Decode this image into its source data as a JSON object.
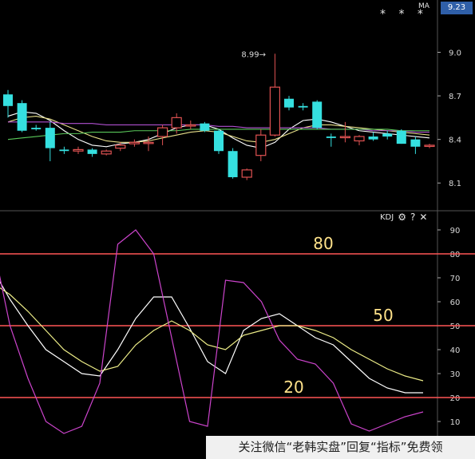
{
  "toolbar": {
    "current_price": "9.23",
    "ma_label": "MA",
    "stars": "* * *",
    "kdj_label": "KDJ",
    "gear_icon": "⚙",
    "help_icon": "?",
    "close_icon": "✕"
  },
  "watermark": "关注微信“老韩实盘”回复“指标”免费领",
  "colors": {
    "up": "#e05252",
    "down": "#35e0e0",
    "k_line": "#ffffff",
    "d_line": "#eeee88",
    "j_line": "#cc44cc",
    "ref_line": "#ff5555",
    "ref_label": "#ffe28a",
    "ma_white": "#ffffff",
    "ma_yellow": "#e8e08a",
    "ma_purple": "#b050d0",
    "ma_green": "#5ac85a"
  },
  "chart_data": [
    {
      "type": "candlestick",
      "title": "",
      "y_ticks": [
        "9.0",
        "8.7",
        "8.4",
        "8.1"
      ],
      "ylim": [
        7.92,
        9.25
      ],
      "annotation": {
        "text": "8.99",
        "candle_index": 19
      },
      "candles": [
        {
          "o": 8.71,
          "h": 8.74,
          "l": 8.55,
          "c": 8.63
        },
        {
          "o": 8.65,
          "h": 8.67,
          "l": 8.45,
          "c": 8.46
        },
        {
          "o": 8.48,
          "h": 8.5,
          "l": 8.46,
          "c": 8.47
        },
        {
          "o": 8.48,
          "h": 8.52,
          "l": 8.25,
          "c": 8.34
        },
        {
          "o": 8.33,
          "h": 8.35,
          "l": 8.3,
          "c": 8.32
        },
        {
          "o": 8.32,
          "h": 8.35,
          "l": 8.3,
          "c": 8.33
        },
        {
          "o": 8.33,
          "h": 8.34,
          "l": 8.28,
          "c": 8.3
        },
        {
          "o": 8.3,
          "h": 8.33,
          "l": 8.29,
          "c": 8.32
        },
        {
          "o": 8.34,
          "h": 8.38,
          "l": 8.32,
          "c": 8.36
        },
        {
          "o": 8.37,
          "h": 8.4,
          "l": 8.35,
          "c": 8.38
        },
        {
          "o": 8.38,
          "h": 8.42,
          "l": 8.32,
          "c": 8.38
        },
        {
          "o": 8.42,
          "h": 8.5,
          "l": 8.36,
          "c": 8.48
        },
        {
          "o": 8.48,
          "h": 8.58,
          "l": 8.44,
          "c": 8.55
        },
        {
          "o": 8.5,
          "h": 8.53,
          "l": 8.47,
          "c": 8.5
        },
        {
          "o": 8.51,
          "h": 8.52,
          "l": 8.45,
          "c": 8.46
        },
        {
          "o": 8.46,
          "h": 8.47,
          "l": 8.3,
          "c": 8.32
        },
        {
          "o": 8.32,
          "h": 8.34,
          "l": 8.13,
          "c": 8.14
        },
        {
          "o": 8.14,
          "h": 8.2,
          "l": 8.12,
          "c": 8.19
        },
        {
          "o": 8.29,
          "h": 8.47,
          "l": 8.25,
          "c": 8.43
        },
        {
          "o": 8.43,
          "h": 8.99,
          "l": 8.42,
          "c": 8.76
        },
        {
          "o": 8.68,
          "h": 8.7,
          "l": 8.6,
          "c": 8.62
        },
        {
          "o": 8.63,
          "h": 8.65,
          "l": 8.6,
          "c": 8.62
        },
        {
          "o": 8.66,
          "h": 8.67,
          "l": 8.47,
          "c": 8.48
        },
        {
          "o": 8.42,
          "h": 8.44,
          "l": 8.35,
          "c": 8.41
        },
        {
          "o": 8.42,
          "h": 8.52,
          "l": 8.38,
          "c": 8.42
        },
        {
          "o": 8.39,
          "h": 8.43,
          "l": 8.36,
          "c": 8.42
        },
        {
          "o": 8.42,
          "h": 8.45,
          "l": 8.39,
          "c": 8.4
        },
        {
          "o": 8.44,
          "h": 8.46,
          "l": 8.4,
          "c": 8.42
        },
        {
          "o": 8.46,
          "h": 8.47,
          "l": 8.37,
          "c": 8.37
        },
        {
          "o": 8.4,
          "h": 8.42,
          "l": 8.3,
          "c": 8.35
        },
        {
          "o": 8.36,
          "h": 8.37,
          "l": 8.34,
          "c": 8.36
        }
      ],
      "ma_series": [
        {
          "color": "#ffffff",
          "values": [
            8.56,
            8.59,
            8.58,
            8.53,
            8.46,
            8.4,
            8.36,
            8.35,
            8.37,
            8.38,
            8.4,
            8.44,
            8.48,
            8.5,
            8.5,
            8.47,
            8.41,
            8.36,
            8.34,
            8.38,
            8.47,
            8.53,
            8.54,
            8.52,
            8.49,
            8.46,
            8.45,
            8.44,
            8.43,
            8.42,
            8.41
          ]
        },
        {
          "color": "#e8e08a",
          "values": [
            8.52,
            8.55,
            8.56,
            8.54,
            8.5,
            8.46,
            8.42,
            8.39,
            8.38,
            8.38,
            8.39,
            8.41,
            8.43,
            8.45,
            8.46,
            8.45,
            8.42,
            8.39,
            8.38,
            8.4,
            8.44,
            8.48,
            8.5,
            8.5,
            8.49,
            8.48,
            8.47,
            8.46,
            8.45,
            8.44,
            8.43
          ]
        },
        {
          "color": "#b050d0",
          "values": [
            8.52,
            8.52,
            8.52,
            8.52,
            8.51,
            8.51,
            8.51,
            8.5,
            8.5,
            8.5,
            8.5,
            8.5,
            8.5,
            8.5,
            8.5,
            8.49,
            8.49,
            8.48,
            8.48,
            8.48,
            8.48,
            8.48,
            8.48,
            8.47,
            8.47,
            8.47,
            8.46,
            8.46,
            8.46,
            8.45,
            8.45
          ]
        },
        {
          "color": "#5ac85a",
          "values": [
            8.4,
            8.41,
            8.42,
            8.43,
            8.44,
            8.44,
            8.45,
            8.45,
            8.45,
            8.46,
            8.46,
            8.46,
            8.46,
            8.47,
            8.47,
            8.47,
            8.47,
            8.47,
            8.47,
            8.47,
            8.47,
            8.47,
            8.47,
            8.47,
            8.47,
            8.47,
            8.47,
            8.47,
            8.46,
            8.46,
            8.46
          ]
        }
      ]
    },
    {
      "type": "line",
      "title": "KDJ",
      "y_ticks": [
        90,
        80,
        70,
        60,
        50,
        40,
        30,
        20,
        10
      ],
      "ylim": [
        4,
        92
      ],
      "reference_lines": [
        {
          "value": 80,
          "label": "80"
        },
        {
          "value": 50,
          "label": "50"
        },
        {
          "value": 20,
          "label": "20"
        }
      ],
      "series": [
        {
          "key": "K",
          "values": [
            74,
            61,
            50,
            40,
            35,
            30,
            29,
            40,
            53,
            62,
            62,
            49,
            35,
            30,
            48,
            53,
            55,
            50,
            45,
            42,
            35,
            28,
            24,
            22,
            22
          ]
        },
        {
          "key": "D",
          "values": [
            68,
            63,
            56,
            48,
            40,
            35,
            31,
            33,
            42,
            48,
            52,
            48,
            42,
            40,
            46,
            48,
            50,
            50,
            48,
            45,
            40,
            36,
            32,
            29,
            27
          ]
        },
        {
          "key": "J",
          "values": [
            86,
            50,
            28,
            10,
            5,
            8,
            26,
            84,
            90,
            80,
            45,
            10,
            8,
            69,
            68,
            60,
            44,
            36,
            34,
            26,
            9,
            6,
            9,
            12,
            14
          ]
        }
      ]
    }
  ]
}
